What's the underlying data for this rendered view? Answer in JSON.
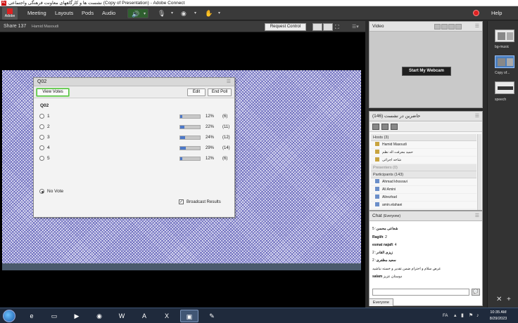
{
  "window": {
    "icon": "Ac",
    "title": "نشست ها و کارگاههای معاونت فرهنگی واجتماعی (Copy of Presentation) - Adobe Connect"
  },
  "menubar": {
    "logo_text": "Adobe",
    "items": [
      "Meeting",
      "Layouts",
      "Pods",
      "Audio"
    ],
    "help": "Help",
    "icons": {
      "speaker": "speaker-icon",
      "mic": "microphone-icon",
      "camera": "webcam-icon",
      "status": "raise-hand-icon",
      "record": "record-icon"
    },
    "accent_green": "#5fe05f",
    "record_color": "#dd2222"
  },
  "share_pod": {
    "title": "Share 137",
    "presenter": "Hamid Masoudi",
    "request_control": "Request Control"
  },
  "poll": {
    "title": "Q02",
    "view_votes": "View Votes",
    "edit": "Edit",
    "end_poll": "End Poll",
    "question": "Q02",
    "options": [
      {
        "label": "1",
        "percent": "12%",
        "count": "(6)",
        "fill": 0.12
      },
      {
        "label": "2",
        "percent": "22%",
        "count": "(11)",
        "fill": 0.22
      },
      {
        "label": "3",
        "percent": "24%",
        "count": "(12)",
        "fill": 0.24
      },
      {
        "label": "4",
        "percent": "29%",
        "count": "(14)",
        "fill": 0.29
      },
      {
        "label": "5",
        "percent": "12%",
        "count": "(6)",
        "fill": 0.12
      }
    ],
    "no_vote": "No Vote",
    "broadcast": "Broadcast Results",
    "broadcast_checked": true,
    "bar_color": "#4c78c8"
  },
  "video_pod": {
    "title": "Video",
    "start_webcam": "Start My Webcam"
  },
  "attendees_pod": {
    "title": "حاضرین در نشست",
    "count": "(146)",
    "hosts_group": "Hosts (3)",
    "hosts": [
      "Hamid Masoudi",
      "حمید معرفت اله نظم",
      "شاخه اجرائی"
    ],
    "presenters_group": "Presenters (0)",
    "participants_group": "Participants (143)",
    "participants": [
      "Ahmad khosravi",
      "Ali Amini",
      "Alirezhad",
      "amin.elahaei"
    ]
  },
  "chat_pod": {
    "title": "Chat",
    "audience": "(Everyone)",
    "messages": [
      {
        "name": "شعاعی محسن",
        "text": "5"
      },
      {
        "name": "Ragiih",
        "text": "2"
      },
      {
        "name": "esmat najafi",
        "text": "4"
      },
      {
        "name": "زیزی القادر",
        "text": "2"
      },
      {
        "name": "سعید مظفری",
        "text": "2"
      },
      {
        "name": "",
        "text": "عرض سلام و احترام ضمن تقدیر و خسته نباشید"
      },
      {
        "name": "salam",
        "text": "دوستان عزیز"
      }
    ],
    "tab": "Everyone"
  },
  "layouts_rail": {
    "items": [
      "bg-music",
      "Copy of...",
      "speech"
    ],
    "selected_index": 1
  },
  "taskbar": {
    "apps": [
      {
        "name": "internet-explorer-icon",
        "glyph": "e"
      },
      {
        "name": "file-explorer-icon",
        "glyph": "▭"
      },
      {
        "name": "media-player-icon",
        "glyph": "▶"
      },
      {
        "name": "chrome-icon",
        "glyph": "◉"
      },
      {
        "name": "word-icon",
        "glyph": "W"
      },
      {
        "name": "acrobat-icon",
        "glyph": "A"
      },
      {
        "name": "excel-icon",
        "glyph": "X"
      },
      {
        "name": "adobe-connect-icon",
        "glyph": "▣"
      },
      {
        "name": "paint-icon",
        "glyph": "✎"
      }
    ],
    "language": "FA",
    "time": "10:35 AM",
    "date": "8/29/2023"
  }
}
